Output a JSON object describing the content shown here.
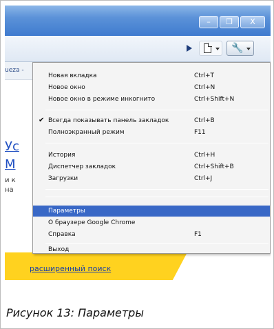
{
  "window": {
    "minimize": "–",
    "maximize": "❐",
    "close": "X"
  },
  "toolbar": {
    "play_icon": "play-icon",
    "page_icon": "page-icon",
    "wrench_icon": "wrench-icon",
    "wrench_glyph": "🔧"
  },
  "bookmarks_bar": {
    "text": "ueza - "
  },
  "content": {
    "link1": "Ус",
    "link2": "М",
    "text1": "и к",
    "text2": "на",
    "advanced_search": "расширенный поиск"
  },
  "menu": {
    "items": [
      {
        "label": "Новая вкладка",
        "shortcut": "Ctrl+T"
      },
      {
        "label": "Новое окно",
        "shortcut": "Ctrl+N"
      },
      {
        "label": "Новое окно в режиме инкогнито",
        "shortcut": "Ctrl+Shift+N"
      },
      {
        "label": "Всегда показывать панель закладок",
        "shortcut": "Ctrl+B",
        "checked": true
      },
      {
        "label": "Полноэкранный режим",
        "shortcut": "F11"
      },
      {
        "label": "История",
        "shortcut": "Ctrl+H"
      },
      {
        "label": "Диспетчер закладок",
        "shortcut": "Ctrl+Shift+B"
      },
      {
        "label": "Загрузки",
        "shortcut": "Ctrl+J"
      },
      {
        "label": "Параметры",
        "shortcut": "",
        "selected": true
      },
      {
        "label": "О браузере Google Chrome",
        "shortcut": ""
      },
      {
        "label": "Справка",
        "shortcut": "F1"
      },
      {
        "label": "Выход",
        "shortcut": ""
      }
    ],
    "check_mark": "✔"
  },
  "colors": {
    "selection": "#3968c6",
    "title_bar": "#3f7bcf",
    "yellow_band": "#ffd21f"
  },
  "caption": "Рисунок 13: Параметры"
}
